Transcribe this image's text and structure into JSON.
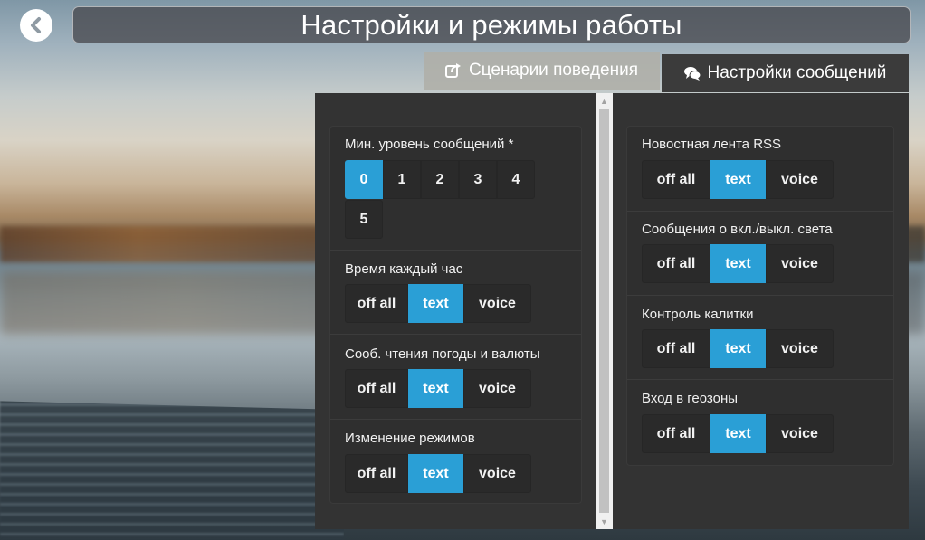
{
  "header": {
    "title": "Настройки и режимы работы"
  },
  "tabs": {
    "scenarios": {
      "label": "Сценарии поведения",
      "icon": "share-square-icon"
    },
    "messages": {
      "label": "Настройки сообщений",
      "icon": "comments-icon"
    }
  },
  "options": {
    "off": "off all",
    "text": "text",
    "voice": "voice"
  },
  "left": {
    "min_level": {
      "label": "Мин. уровень сообщений *",
      "values": [
        "0",
        "1",
        "2",
        "3",
        "4",
        "5"
      ],
      "selected": "0"
    },
    "hourly": {
      "label": "Время каждый час",
      "selected": "text"
    },
    "weather": {
      "label": "Сооб. чтения погоды и валюты",
      "selected": "text"
    },
    "modes": {
      "label": "Изменение режимов",
      "selected": "text"
    }
  },
  "right": {
    "rss": {
      "label": "Новостная лента RSS",
      "selected": "text"
    },
    "light": {
      "label": "Сообщения о вкл./выкл. света",
      "selected": "text"
    },
    "gate": {
      "label": "Контроль калитки",
      "selected": "text"
    },
    "geofence": {
      "label": "Вход в геозоны",
      "selected": "text"
    }
  },
  "colors": {
    "accent": "#2a9fd6",
    "panel": "#333333",
    "button": "#2a2a2a"
  }
}
